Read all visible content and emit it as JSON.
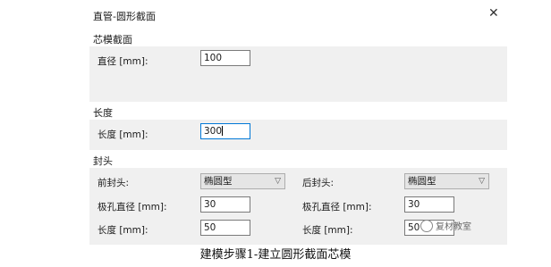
{
  "window": {
    "title": "直管-圆形截面"
  },
  "core_section": {
    "header": "芯模截面",
    "diameter": {
      "label": "直径 [mm]:",
      "value": "100"
    }
  },
  "length_section": {
    "header": "长度",
    "length": {
      "label": "长度 [mm]:",
      "value": "300"
    }
  },
  "head_section": {
    "header": "封头",
    "front_head": {
      "type_label": "前封头:",
      "type_value": "椭圆型",
      "pole_label": "极孔直径 [mm]:",
      "pole_value": "30",
      "len_label": "长度 [mm]:",
      "len_value": "50"
    },
    "rear_head": {
      "type_label": "后封头:",
      "type_value": "椭圆型",
      "pole_label": "极孔直径 [mm]:",
      "pole_value": "30",
      "len_label": "长度 [mm]:",
      "len_value": "50"
    }
  },
  "watermark": "复材教室",
  "caption": "建模步骤1-建立圆形截面芯模"
}
